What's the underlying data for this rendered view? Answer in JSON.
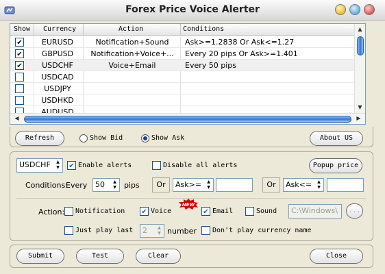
{
  "window": {
    "title": "Forex Price Voice Alerter"
  },
  "grid": {
    "headers": [
      "Show",
      "Currency",
      "Action",
      "Conditions"
    ],
    "rows": [
      {
        "show": true,
        "currency": "EURUSD",
        "action": "Notification+Sound",
        "conditions": "Ask>=1.2838 Or Ask<=1.27"
      },
      {
        "show": true,
        "currency": "GBPUSD",
        "action": "Notification+Voice+...",
        "conditions": "Every 20 pips Or Ask>=1.401"
      },
      {
        "show": true,
        "currency": "USDCHF",
        "action": "Voice+Email",
        "conditions": "Every 50 pips"
      },
      {
        "show": false,
        "currency": "USDCAD",
        "action": "",
        "conditions": ""
      },
      {
        "show": false,
        "currency": "USDJPY",
        "action": "",
        "conditions": ""
      },
      {
        "show": false,
        "currency": "USDHKD",
        "action": "",
        "conditions": ""
      },
      {
        "show": false,
        "currency": "AUDUSD",
        "action": "",
        "conditions": ""
      }
    ]
  },
  "toolbar": {
    "refresh": "Refresh",
    "show_bid": "Show Bid",
    "show_ask": "Show Ask",
    "selected_mode": "Show Ask",
    "about": "About US"
  },
  "settings": {
    "currency_select": "USDCHF",
    "enable_alerts": "Enable alerts",
    "enable_alerts_checked": true,
    "disable_all": "Disable all alerts",
    "disable_all_checked": false,
    "popup_price": "Popup price",
    "conditions_label": "Conditions:",
    "every_label": "Every",
    "every_value": "50",
    "pips_label": "pips",
    "or1": "Or",
    "cond1_op": "Ask>=",
    "cond1_value": "",
    "or2": "Or",
    "cond2_op": "Ask<=",
    "cond2_value": "",
    "action_label": "Action:",
    "notification": "Notification",
    "notification_checked": false,
    "voice": "Voice",
    "voice_checked": true,
    "new_badge": "NEW",
    "email": "Email",
    "email_checked": true,
    "sound": "Sound",
    "sound_checked": false,
    "sound_path": "C:\\Windows\\",
    "browse": "...",
    "just_play_last": "Just play last",
    "just_play_last_checked": false,
    "number_value": "2",
    "number_label": "number",
    "dont_play": "Don't play currency name",
    "dont_play_checked": false
  },
  "footer": {
    "submit": "Submit",
    "test": "Test",
    "clear": "Clear",
    "close": "Close"
  }
}
